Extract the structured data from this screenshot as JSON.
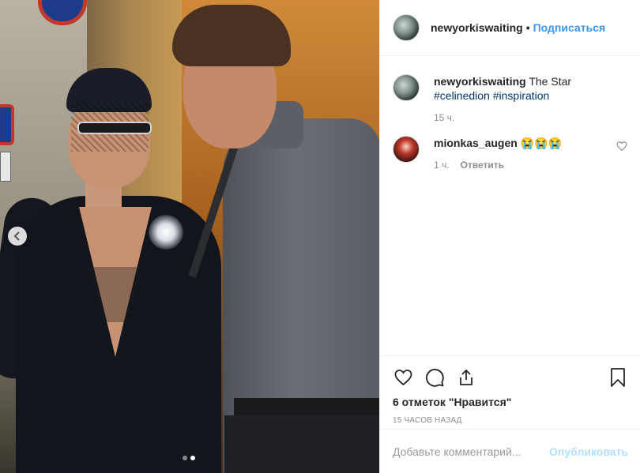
{
  "post": {
    "username": "newyorkiswaiting",
    "separator": "•",
    "follow_label": "Подписаться",
    "carousel": {
      "total": 2,
      "active_index": 1
    }
  },
  "caption": {
    "username": "newyorkiswaiting",
    "text": "The Star",
    "hashtags": [
      "#celinedion",
      "#inspiration"
    ],
    "time": "15 ч."
  },
  "comment": {
    "username": "mionkas_augen",
    "text": "😭😭😭",
    "time": "1 ч.",
    "reply_label": "Ответить"
  },
  "actions": {
    "likes": "6 отметок \"Нравится\"",
    "time_ago": "15 ЧАСОВ НАЗАД",
    "icons": [
      "heart-icon",
      "comment-icon",
      "share-icon",
      "bookmark-icon"
    ]
  },
  "add_comment": {
    "placeholder": "Добавьте комментарий...",
    "publish_label": "Опубликовать"
  },
  "colors": {
    "accent": "#3897f0",
    "hashtag": "#003569",
    "publish_disabled": "#b2dffc",
    "muted": "#8e8e8e"
  }
}
